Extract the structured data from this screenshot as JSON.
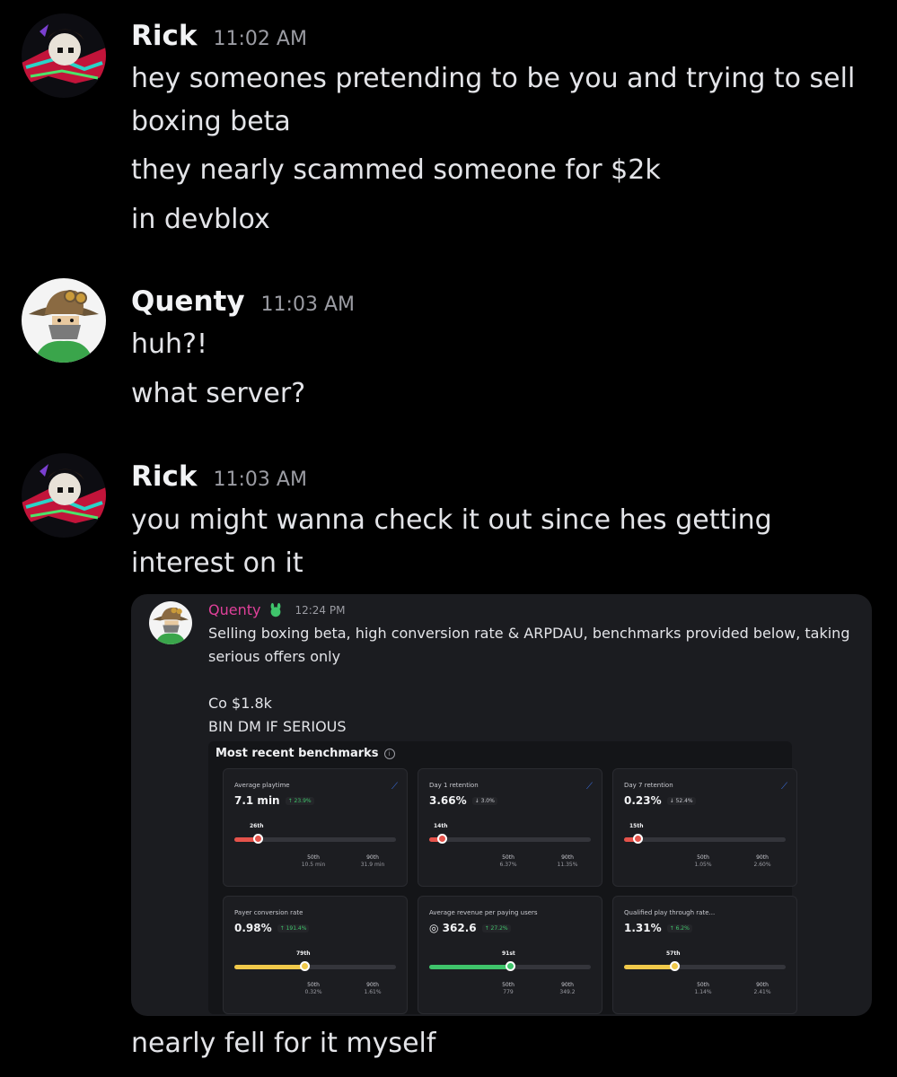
{
  "messages": [
    {
      "author": "Rick",
      "time": "11:02 AM",
      "avatar_icon": "rick-avatar-icon",
      "lines": [
        "hey someones pretending to be you and trying to sell",
        "boxing beta",
        "they nearly scammed someone for $2k",
        "in devblox"
      ]
    },
    {
      "author": "Quenty",
      "time": "11:03 AM",
      "avatar_icon": "quenty-avatar-icon",
      "lines": [
        "huh?!",
        "what server?"
      ]
    },
    {
      "author": "Rick",
      "time": "11:03 AM",
      "avatar_icon": "rick-avatar-icon",
      "lines": [
        "you might wanna check it out since hes getting",
        "interest on it"
      ],
      "after_embed": "nearly fell for it myself"
    }
  ],
  "embed": {
    "author": "Quenty",
    "author_color": "#e0409a",
    "time": "12:24 PM",
    "badge_icon": "green-bunny-badge-icon",
    "lines": [
      "Selling boxing beta, high conversion rate & ARPDAU, benchmarks provided below, taking",
      "serious offers only",
      "Co $1.8k",
      "BIN DM IF SERIOUS"
    ],
    "benchmarks": {
      "title": "Most recent benchmarks",
      "cards": [
        {
          "label": "Average playtime",
          "value": "7.1 min",
          "delta": "↑ 23.9%",
          "delta_dir": "up",
          "percentile": "26th",
          "fill_color": "#e5534b",
          "fill_fraction": 0.26,
          "p50_label": "50th",
          "p50_value": "10.5 min",
          "p90_label": "90th",
          "p90_value": "31.9 min",
          "trend": true
        },
        {
          "label": "Day 1 retention",
          "value": "3.66%",
          "delta": "↓ 3.0%",
          "delta_dir": "down",
          "percentile": "14th",
          "fill_color": "#e5534b",
          "fill_fraction": 0.14,
          "p50_label": "50th",
          "p50_value": "6.37%",
          "p90_label": "90th",
          "p90_value": "11.35%",
          "trend": true
        },
        {
          "label": "Day 7 retention",
          "value": "0.23%",
          "delta": "↓ 52.4%",
          "delta_dir": "down",
          "percentile": "15th",
          "fill_color": "#e5534b",
          "fill_fraction": 0.15,
          "p50_label": "50th",
          "p50_value": "1.05%",
          "p90_label": "90th",
          "p90_value": "2.60%",
          "trend": true
        },
        {
          "label": "Payer conversion rate",
          "value": "0.98%",
          "delta": "↑ 191.4%",
          "delta_dir": "up",
          "percentile": "79th",
          "fill_color": "#f0c94a",
          "fill_fraction": 0.79,
          "p50_label": "50th",
          "p50_value": "0.32%",
          "p90_label": "90th",
          "p90_value": "1.61%",
          "trend": false
        },
        {
          "label": "Average revenue per paying users",
          "value": "◎ 362.6",
          "delta": "↑ 27.2%",
          "delta_dir": "up",
          "percentile": "91st",
          "fill_color": "#3fc46b",
          "fill_fraction": 0.91,
          "p50_label": "50th",
          "p50_value": "779",
          "p90_label": "90th",
          "p90_value": "349.2",
          "trend": false
        },
        {
          "label": "Qualified play through rate...",
          "value": "1.31%",
          "delta": "↑ 6.2%",
          "delta_dir": "up",
          "percentile": "57th",
          "fill_color": "#f0c94a",
          "fill_fraction": 0.57,
          "p50_label": "50th",
          "p50_value": "1.14%",
          "p90_label": "90th",
          "p90_value": "2.41%",
          "trend": false
        }
      ]
    }
  }
}
